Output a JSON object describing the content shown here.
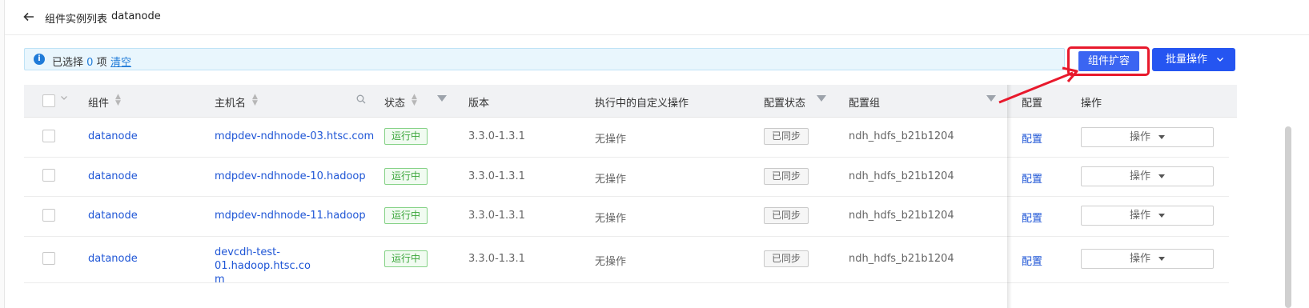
{
  "header": {
    "back_icon": "arrow-left-icon",
    "title": "组件实例列表",
    "subtitle": "datanode"
  },
  "alert": {
    "icon": "info-icon",
    "prefix": "已选择",
    "count": "0",
    "suffix": "项",
    "clear_label": "清空"
  },
  "actions": {
    "expand_label": "组件扩容",
    "batch_label": "批量操作",
    "batch_icon": "chevron-down-icon"
  },
  "table": {
    "columns": {
      "component": "组件",
      "hostname": "主机名",
      "status": "状态",
      "version": "版本",
      "custom_op": "执行中的自定义操作",
      "config_status": "配置状态",
      "config_group": "配置组",
      "config": "配置",
      "operation": "操作"
    },
    "rows": [
      {
        "component": "datanode",
        "hostname": "mdpdev-ndhnode-03.htsc.com",
        "status": "运行中",
        "version": "3.3.0-1.3.1",
        "custom_op": "无操作",
        "config_status": "已同步",
        "config_group": "ndh_hdfs_b21b1204",
        "config": "配置",
        "operation": "操作"
      },
      {
        "component": "datanode",
        "hostname": "mdpdev-ndhnode-10.hadoop",
        "status": "运行中",
        "version": "3.3.0-1.3.1",
        "custom_op": "无操作",
        "config_status": "已同步",
        "config_group": "ndh_hdfs_b21b1204",
        "config": "配置",
        "operation": "操作"
      },
      {
        "component": "datanode",
        "hostname": "mdpdev-ndhnode-11.hadoop",
        "status": "运行中",
        "version": "3.3.0-1.3.1",
        "custom_op": "无操作",
        "config_status": "已同步",
        "config_group": "ndh_hdfs_b21b1204",
        "config": "配置",
        "operation": "操作"
      },
      {
        "component": "datanode",
        "hostname_line1": "devcdh-test-01.hadoop.htsc.co",
        "hostname_line2": "m",
        "status": "运行中",
        "version": "3.3.0-1.3.1",
        "custom_op": "无操作",
        "config_status": "已同步",
        "config_group": "ndh_hdfs_b21b1204",
        "config": "配置",
        "operation": "操作"
      }
    ]
  },
  "colors": {
    "primary": "#2555f1",
    "link": "#1f56d6",
    "highlight_red": "#e8192c",
    "status_green": "#3aa53a"
  }
}
